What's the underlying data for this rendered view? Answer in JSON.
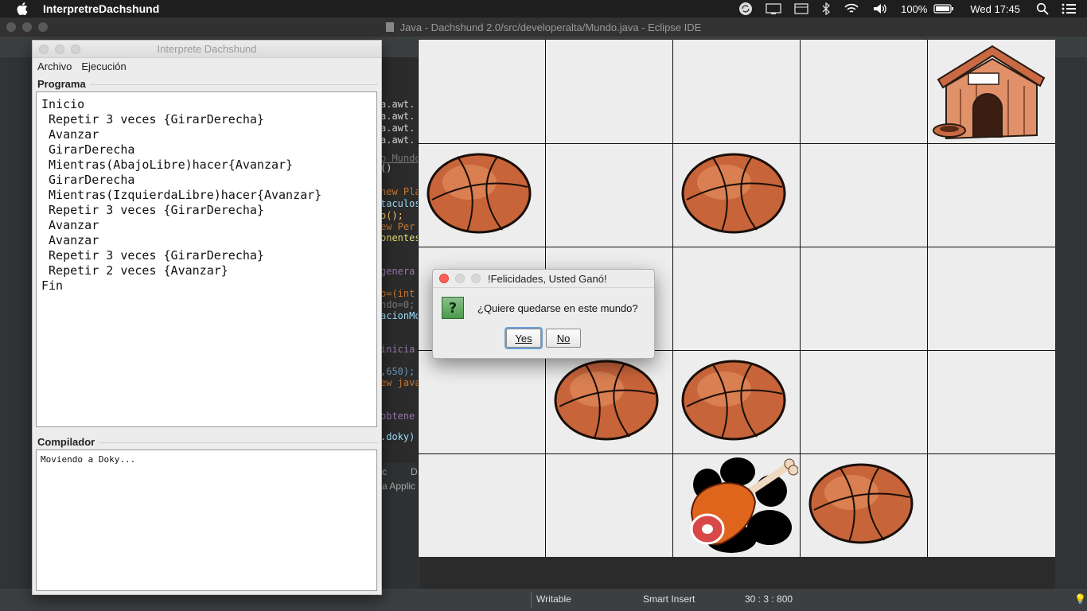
{
  "menubar": {
    "app_name": "InterpretreDachshund",
    "battery": "100%",
    "clock": "Wed 17:45"
  },
  "eclipse": {
    "title": "Java - Dachshund 2.0/src/developeralta/Mundo.java - Eclipse IDE",
    "status_writable": "Writable",
    "status_insert": "Smart Insert",
    "status_position": "30 : 3 : 800",
    "code_fragments": [
      "a.awt.",
      "a.awt.",
      "a.awt.",
      "a.awt.",
      "o Mundo",
      "()",
      "new Pla",
      "taculos",
      "o();",
      "ew Per",
      "onentes",
      "genera",
      "o=(int",
      "ndo=0;",
      "acionMo",
      "inicia",
      ",650);",
      "ew java",
      "obtene",
      ".doky)"
    ],
    "lower_fragments": [
      "c",
      "D",
      "a Applic"
    ]
  },
  "interpreter": {
    "title": "Interprete Dachshund",
    "menu": [
      "Archivo",
      "Ejecución"
    ],
    "program_label": "Programa",
    "program_lines": [
      "Inicio",
      " Repetir 3 veces {GirarDerecha}",
      " Avanzar",
      " GirarDerecha",
      " Mientras(AbajoLibre)hacer{Avanzar}",
      " GirarDerecha",
      " Mientras(IzquierdaLibre)hacer{Avanzar}",
      " Repetir 3 veces {GirarDerecha}",
      " Avanzar",
      " Avanzar",
      " Repetir 3 veces {GirarDerecha}",
      " Repetir 2 veces {Avanzar}",
      "Fin"
    ],
    "compiler_label": "Compilador",
    "compiler_output": "Moviendo a Doky..."
  },
  "world": {
    "rows": 5,
    "cols": 5,
    "cells": [
      [
        "empty",
        "empty",
        "empty",
        "empty",
        "doghouse"
      ],
      [
        "ball",
        "empty",
        "ball",
        "empty",
        "empty"
      ],
      [
        "empty",
        "empty",
        "empty",
        "empty",
        "empty"
      ],
      [
        "empty",
        "ball",
        "ball",
        "empty",
        "empty"
      ],
      [
        "empty",
        "empty",
        "meat",
        "ball",
        "empty"
      ]
    ]
  },
  "dialog": {
    "title": "!Felicidades, Usted Ganó!",
    "icon": "question-icon",
    "icon_glyph": "?",
    "message": "¿Quiere quedarse en este mundo?",
    "yes_label": "Yes",
    "no_label": "No"
  }
}
